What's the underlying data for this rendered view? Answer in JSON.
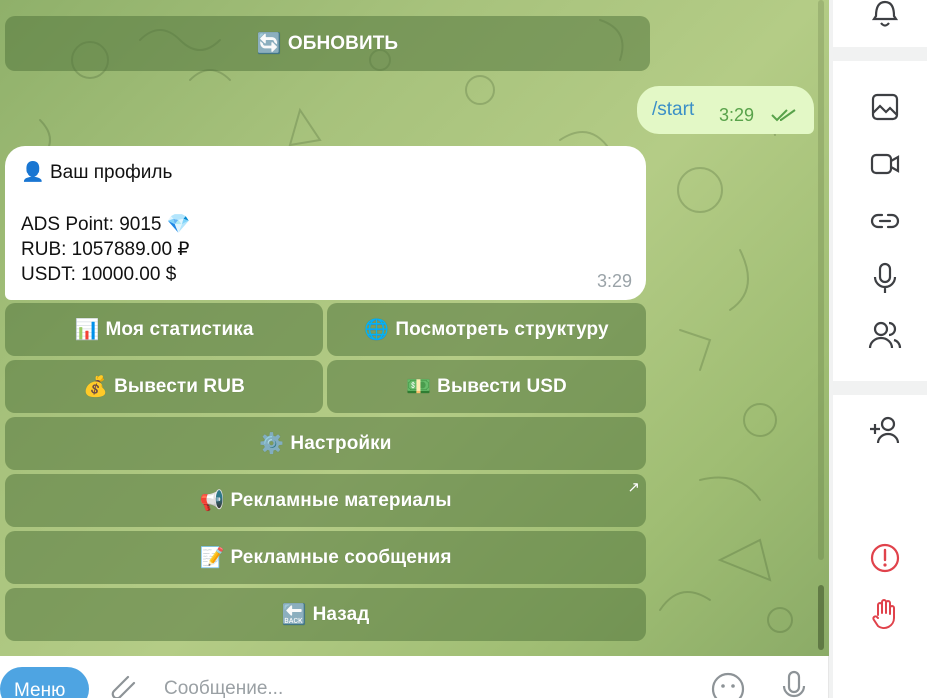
{
  "chat": {
    "refresh_button": {
      "emoji": "🔄",
      "label": "ОБНОВИТЬ"
    },
    "outgoing": {
      "text": "/start",
      "time": "3:29"
    },
    "profile": {
      "title_emoji": "👤",
      "title": "Ваш профиль",
      "ads_point": "ADS Point: 9015",
      "ads_emoji": "💎",
      "rub": "RUB: 1057889.00 ₽",
      "usdt": "USDT: 10000.00 $",
      "time": "3:29"
    },
    "keyboard": [
      {
        "emoji": "📊",
        "label": "Моя статистика"
      },
      {
        "emoji": "🌐",
        "label": "Посмотреть структуру"
      },
      {
        "emoji": "💰",
        "label": "Вывести RUB"
      },
      {
        "emoji": "💵",
        "label": "Вывести USD"
      },
      {
        "emoji": "⚙️",
        "label": "Настройки"
      },
      {
        "emoji": "📢",
        "label": "Рекламные материалы",
        "arrow": "↗"
      },
      {
        "emoji": "📝",
        "label": "Рекламные сообщения"
      },
      {
        "emoji": "🔙",
        "label": "Назад"
      }
    ]
  },
  "input": {
    "menu_label": "Меню",
    "placeholder": "Сообщение..."
  },
  "colors": {
    "accent": "#4ea4e2",
    "icon": "#3d3f43",
    "danger": "#e0424b",
    "outgoing_bg": "#e3f8c6"
  }
}
